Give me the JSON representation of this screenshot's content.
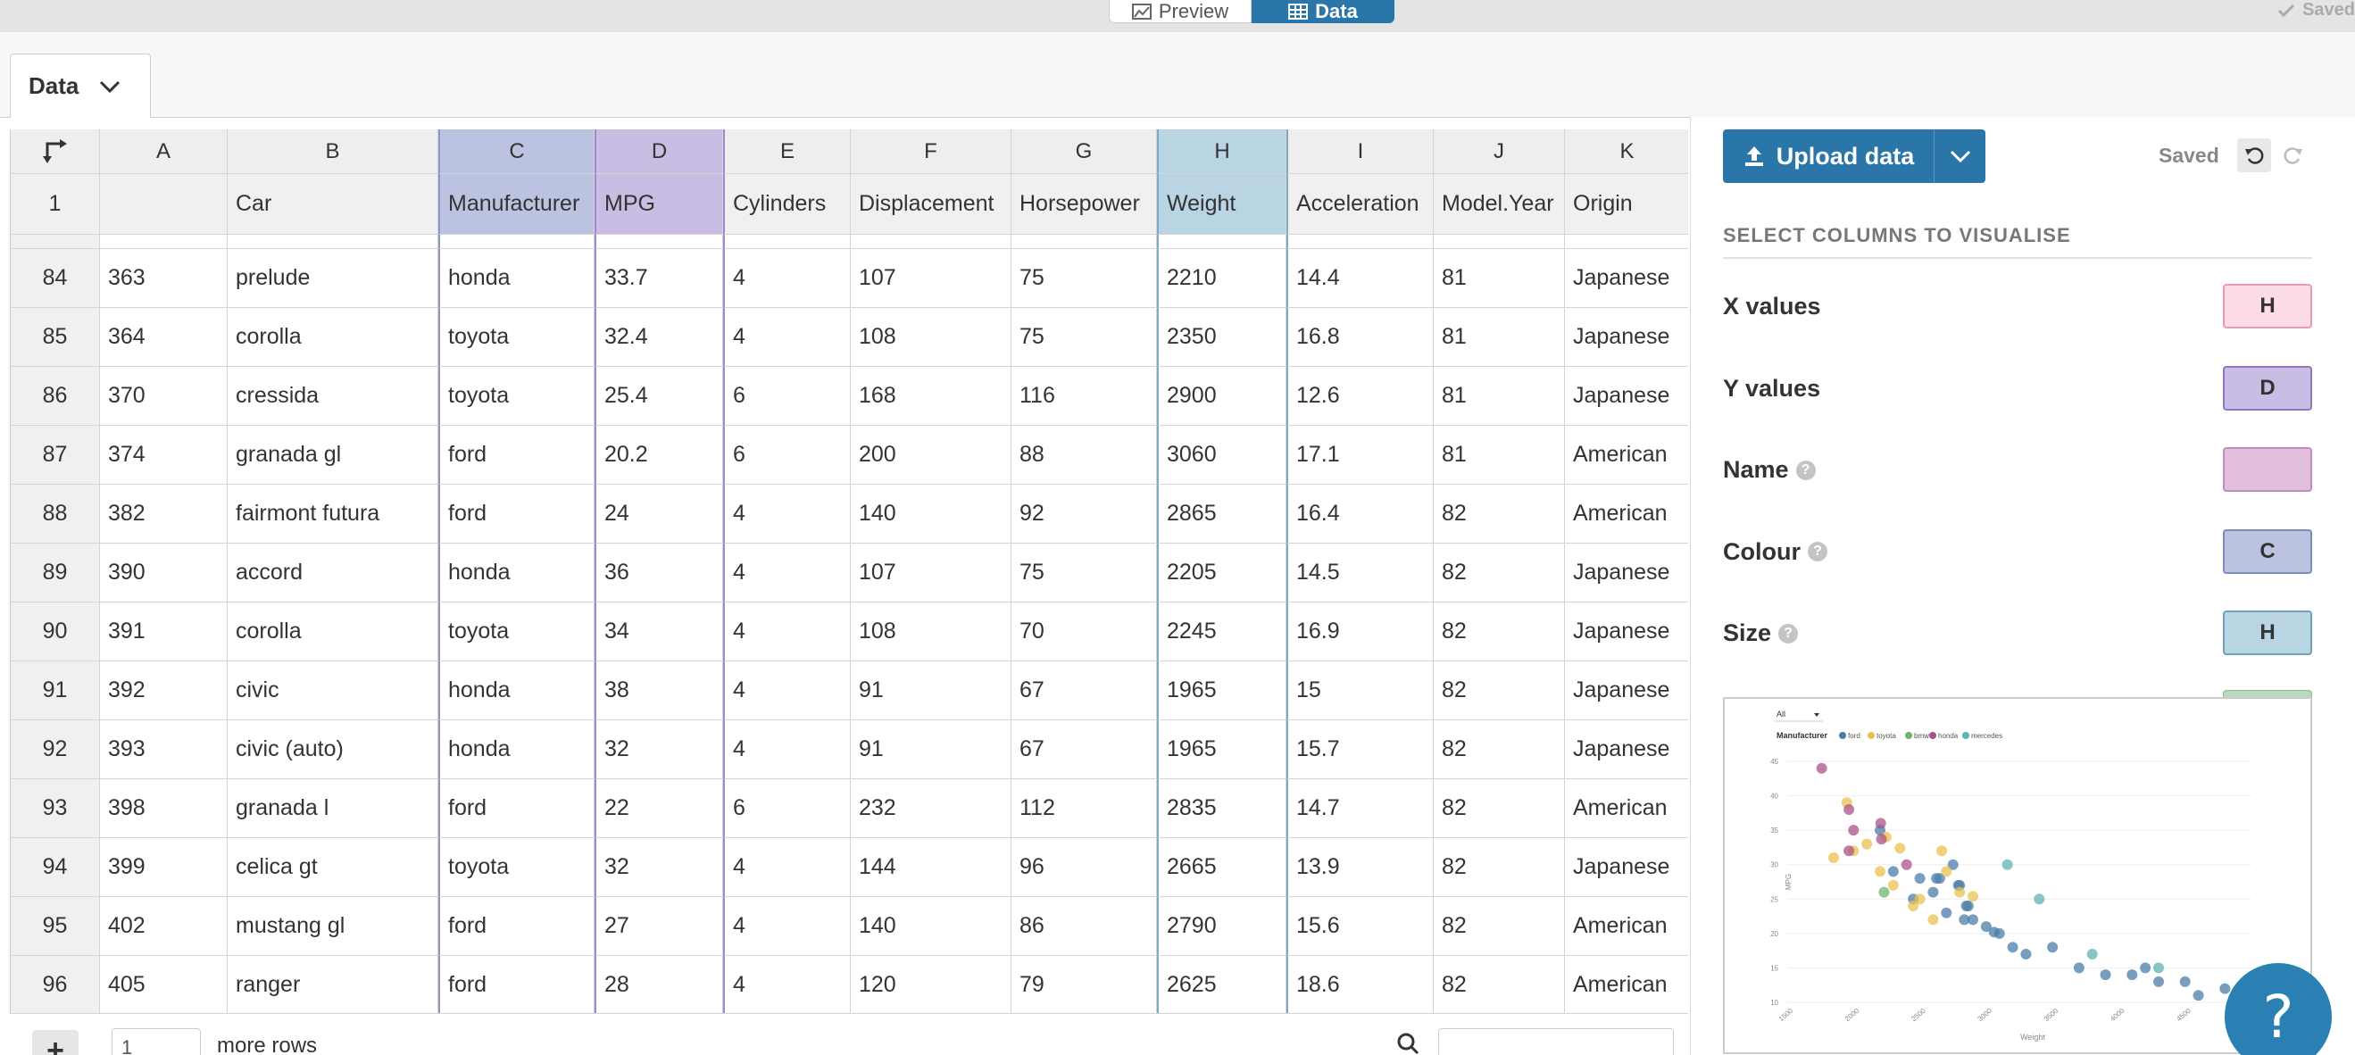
{
  "topbar": {
    "preview_label": "Preview",
    "data_label": "Data",
    "saved_label": "Saved"
  },
  "tab": {
    "label": "Data"
  },
  "grid": {
    "columns": [
      {
        "letter": "A",
        "name": ""
      },
      {
        "letter": "B",
        "name": "Car"
      },
      {
        "letter": "C",
        "name": "Manufacturer"
      },
      {
        "letter": "D",
        "name": "MPG"
      },
      {
        "letter": "E",
        "name": "Cylinders"
      },
      {
        "letter": "F",
        "name": "Displacement"
      },
      {
        "letter": "G",
        "name": "Horsepower"
      },
      {
        "letter": "H",
        "name": "Weight"
      },
      {
        "letter": "I",
        "name": "Acceleration"
      },
      {
        "letter": "J",
        "name": "Model.Year"
      },
      {
        "letter": "K",
        "name": "Origin"
      }
    ],
    "header_row_number": "1",
    "rows": [
      [
        "84",
        "363",
        "prelude",
        "honda",
        "33.7",
        "4",
        "107",
        "75",
        "2210",
        "14.4",
        "81",
        "Japanese"
      ],
      [
        "85",
        "364",
        "corolla",
        "toyota",
        "32.4",
        "4",
        "108",
        "75",
        "2350",
        "16.8",
        "81",
        "Japanese"
      ],
      [
        "86",
        "370",
        "cressida",
        "toyota",
        "25.4",
        "6",
        "168",
        "116",
        "2900",
        "12.6",
        "81",
        "Japanese"
      ],
      [
        "87",
        "374",
        "granada gl",
        "ford",
        "20.2",
        "6",
        "200",
        "88",
        "3060",
        "17.1",
        "81",
        "American"
      ],
      [
        "88",
        "382",
        "fairmont futura",
        "ford",
        "24",
        "4",
        "140",
        "92",
        "2865",
        "16.4",
        "82",
        "American"
      ],
      [
        "89",
        "390",
        "accord",
        "honda",
        "36",
        "4",
        "107",
        "75",
        "2205",
        "14.5",
        "82",
        "Japanese"
      ],
      [
        "90",
        "391",
        "corolla",
        "toyota",
        "34",
        "4",
        "108",
        "70",
        "2245",
        "16.9",
        "82",
        "Japanese"
      ],
      [
        "91",
        "392",
        "civic",
        "honda",
        "38",
        "4",
        "91",
        "67",
        "1965",
        "15",
        "82",
        "Japanese"
      ],
      [
        "92",
        "393",
        "civic (auto)",
        "honda",
        "32",
        "4",
        "91",
        "67",
        "1965",
        "15.7",
        "82",
        "Japanese"
      ],
      [
        "93",
        "398",
        "granada l",
        "ford",
        "22",
        "6",
        "232",
        "112",
        "2835",
        "14.7",
        "82",
        "American"
      ],
      [
        "94",
        "399",
        "celica gt",
        "toyota",
        "32",
        "4",
        "144",
        "96",
        "2665",
        "13.9",
        "82",
        "Japanese"
      ],
      [
        "95",
        "402",
        "mustang gl",
        "ford",
        "27",
        "4",
        "140",
        "86",
        "2790",
        "15.6",
        "82",
        "American"
      ],
      [
        "96",
        "405",
        "ranger",
        "ford",
        "28",
        "4",
        "120",
        "79",
        "2625",
        "18.6",
        "82",
        "American"
      ]
    ]
  },
  "bottom": {
    "add_label": "+",
    "rows_value": "1",
    "more_rows_label": "more rows"
  },
  "panel": {
    "upload_label": "Upload data",
    "saved_label": "Saved",
    "section_title": "SELECT COLUMNS TO VISUALISE",
    "bindings": [
      {
        "label": "X values",
        "column": "H",
        "color": "#fcdce6",
        "border": "#e59ab3",
        "help": false
      },
      {
        "label": "Y values",
        "column": "D",
        "color": "#c9bde3",
        "border": "#8f78c4",
        "help": false
      },
      {
        "label": "Name",
        "column": "",
        "color": "#e3bfdf",
        "border": "#c489bd",
        "help": true
      },
      {
        "label": "Colour",
        "column": "C",
        "color": "#bcc3e0",
        "border": "#7f8bc0",
        "help": true
      },
      {
        "label": "Size",
        "column": "H",
        "color": "#b9d4e2",
        "border": "#6fa0bd",
        "help": true
      }
    ],
    "help_glyph": "?"
  },
  "preview_chart": {
    "filter_label": "All",
    "legend_title": "Manufacturer",
    "legend": [
      {
        "name": "ford",
        "color": "#4a7ea8"
      },
      {
        "name": "toyota",
        "color": "#e8c14e"
      },
      {
        "name": "bmw",
        "color": "#6fb36b"
      },
      {
        "name": "honda",
        "color": "#a9528a"
      },
      {
        "name": "mercedes",
        "color": "#5fb3b0"
      }
    ],
    "y_ticks": [
      "45",
      "40",
      "35",
      "30",
      "25",
      "20",
      "15",
      "10"
    ],
    "x_ticks": [
      "1500",
      "2000",
      "2500",
      "3000",
      "3500",
      "4000",
      "4500"
    ],
    "ylabel": "MPG",
    "xlabel": "Weight"
  },
  "chart_data": {
    "type": "scatter",
    "xlabel": "Weight",
    "ylabel": "MPG",
    "xlim": [
      1500,
      5000
    ],
    "ylim": [
      10,
      45
    ],
    "series": [
      {
        "name": "ford",
        "color": "#4a7ea8",
        "points": [
          [
            2200,
            35
          ],
          [
            2300,
            29
          ],
          [
            2450,
            25
          ],
          [
            2500,
            28
          ],
          [
            2600,
            26
          ],
          [
            2700,
            23
          ],
          [
            2800,
            27
          ],
          [
            2850,
            24
          ],
          [
            2900,
            22
          ],
          [
            3000,
            21
          ],
          [
            3100,
            20
          ],
          [
            3200,
            18
          ],
          [
            3300,
            17
          ],
          [
            3500,
            18
          ],
          [
            3700,
            15
          ],
          [
            3900,
            14
          ],
          [
            4100,
            14
          ],
          [
            4200,
            15
          ],
          [
            4300,
            13
          ],
          [
            4500,
            13
          ],
          [
            4600,
            11
          ],
          [
            4800,
            12
          ],
          [
            2650,
            28
          ],
          [
            2750,
            30
          ],
          [
            3060,
            20.2
          ],
          [
            2865,
            24
          ],
          [
            2835,
            22
          ],
          [
            2790,
            27
          ],
          [
            2625,
            28
          ]
        ]
      },
      {
        "name": "toyota",
        "color": "#e8c14e",
        "points": [
          [
            1850,
            31
          ],
          [
            1950,
            39
          ],
          [
            2000,
            32
          ],
          [
            2100,
            33
          ],
          [
            2200,
            29
          ],
          [
            2300,
            27
          ],
          [
            2350,
            32.4
          ],
          [
            2450,
            24
          ],
          [
            2500,
            25
          ],
          [
            2600,
            22
          ],
          [
            2700,
            29
          ],
          [
            2800,
            26
          ],
          [
            2900,
            25.4
          ],
          [
            2245,
            34
          ],
          [
            2665,
            32
          ]
        ]
      },
      {
        "name": "bmw",
        "color": "#6fb36b",
        "points": [
          [
            2230,
            26
          ]
        ]
      },
      {
        "name": "honda",
        "color": "#a9528a",
        "points": [
          [
            1760,
            44
          ],
          [
            1965,
            38
          ],
          [
            1965,
            32
          ],
          [
            2205,
            36
          ],
          [
            2210,
            33.7
          ],
          [
            2000,
            35
          ],
          [
            2400,
            30
          ]
        ]
      },
      {
        "name": "mercedes",
        "color": "#5fb3b0",
        "points": [
          [
            3160,
            30
          ],
          [
            3400,
            25
          ],
          [
            3800,
            17
          ],
          [
            4300,
            15
          ]
        ]
      }
    ]
  }
}
